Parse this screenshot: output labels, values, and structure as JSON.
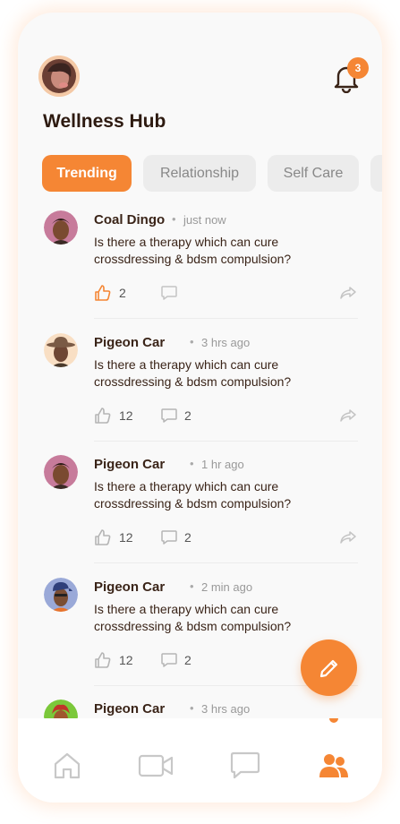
{
  "header": {
    "title": "Wellness Hub",
    "notification_count": "3"
  },
  "tabs": [
    {
      "label": "Trending",
      "active": true
    },
    {
      "label": "Relationship",
      "active": false
    },
    {
      "label": "Self Care",
      "active": false
    }
  ],
  "posts": [
    {
      "author": "Coal Dingo",
      "time": "just now",
      "text": "Is there a therapy which can cure crossdressing & bdsm compulsion?",
      "likes": "2",
      "comments": "",
      "liked": true
    },
    {
      "author": "Pigeon Car",
      "time": "3 hrs ago",
      "text": "Is there a therapy which can cure crossdressing & bdsm compulsion?",
      "likes": "12",
      "comments": "2",
      "liked": false
    },
    {
      "author": "Pigeon Car",
      "time": "1 hr ago",
      "text": "Is there a therapy which can cure crossdressing & bdsm compulsion?",
      "likes": "12",
      "comments": "2",
      "liked": false
    },
    {
      "author": "Pigeon Car",
      "time": "2 min ago",
      "text": "Is there a therapy which can cure crossdressing & bdsm compulsion?",
      "likes": "12",
      "comments": "2",
      "liked": false
    },
    {
      "author": "Pigeon Car",
      "time": "3 hrs ago",
      "text": "",
      "likes": "",
      "comments": "",
      "liked": false
    }
  ],
  "separator": "•",
  "colors": {
    "accent": "#f58634",
    "text": "#3a2418",
    "muted": "#999999"
  },
  "nav": [
    {
      "icon": "home-icon",
      "active": false
    },
    {
      "icon": "video-icon",
      "active": false
    },
    {
      "icon": "chat-icon",
      "active": false
    },
    {
      "icon": "community-icon",
      "active": true
    }
  ]
}
